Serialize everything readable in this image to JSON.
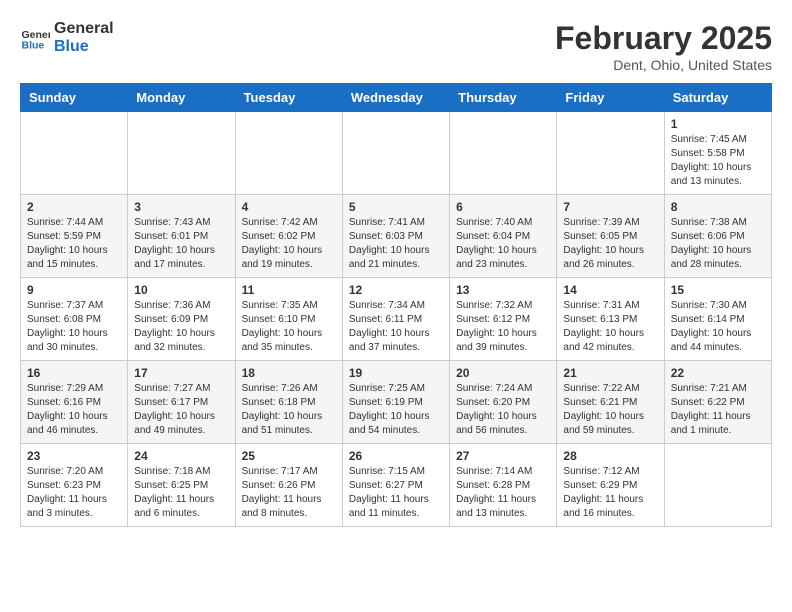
{
  "header": {
    "logo_line1": "General",
    "logo_line2": "Blue",
    "month_title": "February 2025",
    "location": "Dent, Ohio, United States"
  },
  "days_of_week": [
    "Sunday",
    "Monday",
    "Tuesday",
    "Wednesday",
    "Thursday",
    "Friday",
    "Saturday"
  ],
  "weeks": [
    [
      {
        "day": "",
        "info": ""
      },
      {
        "day": "",
        "info": ""
      },
      {
        "day": "",
        "info": ""
      },
      {
        "day": "",
        "info": ""
      },
      {
        "day": "",
        "info": ""
      },
      {
        "day": "",
        "info": ""
      },
      {
        "day": "1",
        "info": "Sunrise: 7:45 AM\nSunset: 5:58 PM\nDaylight: 10 hours and 13 minutes."
      }
    ],
    [
      {
        "day": "2",
        "info": "Sunrise: 7:44 AM\nSunset: 5:59 PM\nDaylight: 10 hours and 15 minutes."
      },
      {
        "day": "3",
        "info": "Sunrise: 7:43 AM\nSunset: 6:01 PM\nDaylight: 10 hours and 17 minutes."
      },
      {
        "day": "4",
        "info": "Sunrise: 7:42 AM\nSunset: 6:02 PM\nDaylight: 10 hours and 19 minutes."
      },
      {
        "day": "5",
        "info": "Sunrise: 7:41 AM\nSunset: 6:03 PM\nDaylight: 10 hours and 21 minutes."
      },
      {
        "day": "6",
        "info": "Sunrise: 7:40 AM\nSunset: 6:04 PM\nDaylight: 10 hours and 23 minutes."
      },
      {
        "day": "7",
        "info": "Sunrise: 7:39 AM\nSunset: 6:05 PM\nDaylight: 10 hours and 26 minutes."
      },
      {
        "day": "8",
        "info": "Sunrise: 7:38 AM\nSunset: 6:06 PM\nDaylight: 10 hours and 28 minutes."
      }
    ],
    [
      {
        "day": "9",
        "info": "Sunrise: 7:37 AM\nSunset: 6:08 PM\nDaylight: 10 hours and 30 minutes."
      },
      {
        "day": "10",
        "info": "Sunrise: 7:36 AM\nSunset: 6:09 PM\nDaylight: 10 hours and 32 minutes."
      },
      {
        "day": "11",
        "info": "Sunrise: 7:35 AM\nSunset: 6:10 PM\nDaylight: 10 hours and 35 minutes."
      },
      {
        "day": "12",
        "info": "Sunrise: 7:34 AM\nSunset: 6:11 PM\nDaylight: 10 hours and 37 minutes."
      },
      {
        "day": "13",
        "info": "Sunrise: 7:32 AM\nSunset: 6:12 PM\nDaylight: 10 hours and 39 minutes."
      },
      {
        "day": "14",
        "info": "Sunrise: 7:31 AM\nSunset: 6:13 PM\nDaylight: 10 hours and 42 minutes."
      },
      {
        "day": "15",
        "info": "Sunrise: 7:30 AM\nSunset: 6:14 PM\nDaylight: 10 hours and 44 minutes."
      }
    ],
    [
      {
        "day": "16",
        "info": "Sunrise: 7:29 AM\nSunset: 6:16 PM\nDaylight: 10 hours and 46 minutes."
      },
      {
        "day": "17",
        "info": "Sunrise: 7:27 AM\nSunset: 6:17 PM\nDaylight: 10 hours and 49 minutes."
      },
      {
        "day": "18",
        "info": "Sunrise: 7:26 AM\nSunset: 6:18 PM\nDaylight: 10 hours and 51 minutes."
      },
      {
        "day": "19",
        "info": "Sunrise: 7:25 AM\nSunset: 6:19 PM\nDaylight: 10 hours and 54 minutes."
      },
      {
        "day": "20",
        "info": "Sunrise: 7:24 AM\nSunset: 6:20 PM\nDaylight: 10 hours and 56 minutes."
      },
      {
        "day": "21",
        "info": "Sunrise: 7:22 AM\nSunset: 6:21 PM\nDaylight: 10 hours and 59 minutes."
      },
      {
        "day": "22",
        "info": "Sunrise: 7:21 AM\nSunset: 6:22 PM\nDaylight: 11 hours and 1 minute."
      }
    ],
    [
      {
        "day": "23",
        "info": "Sunrise: 7:20 AM\nSunset: 6:23 PM\nDaylight: 11 hours and 3 minutes."
      },
      {
        "day": "24",
        "info": "Sunrise: 7:18 AM\nSunset: 6:25 PM\nDaylight: 11 hours and 6 minutes."
      },
      {
        "day": "25",
        "info": "Sunrise: 7:17 AM\nSunset: 6:26 PM\nDaylight: 11 hours and 8 minutes."
      },
      {
        "day": "26",
        "info": "Sunrise: 7:15 AM\nSunset: 6:27 PM\nDaylight: 11 hours and 11 minutes."
      },
      {
        "day": "27",
        "info": "Sunrise: 7:14 AM\nSunset: 6:28 PM\nDaylight: 11 hours and 13 minutes."
      },
      {
        "day": "28",
        "info": "Sunrise: 7:12 AM\nSunset: 6:29 PM\nDaylight: 11 hours and 16 minutes."
      },
      {
        "day": "",
        "info": ""
      }
    ]
  ]
}
